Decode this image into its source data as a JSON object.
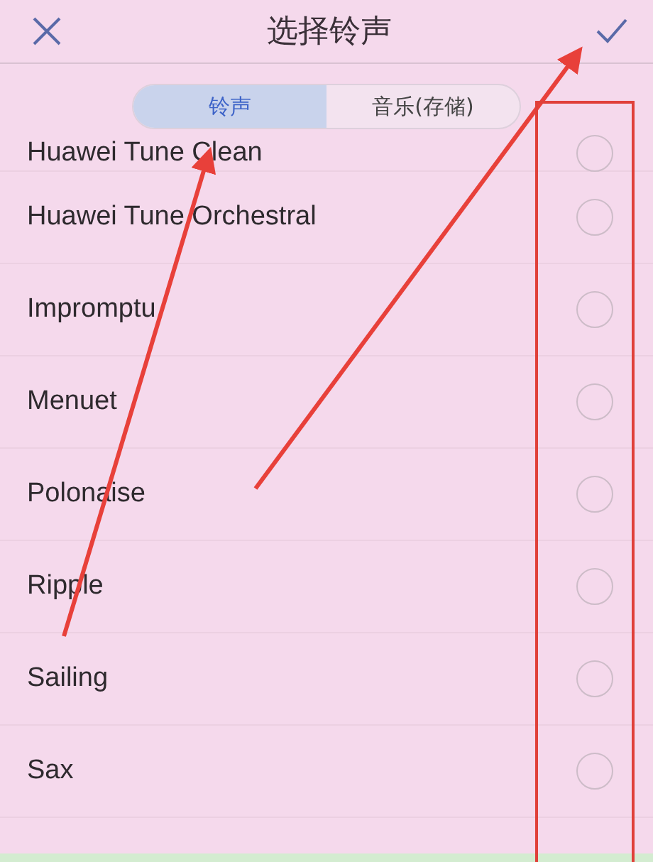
{
  "header": {
    "title": "选择铃声"
  },
  "tabs": [
    {
      "label": "铃声",
      "selected": true
    },
    {
      "label": "音乐(存储)",
      "selected": false
    }
  ],
  "ringtones": [
    {
      "name": "Huawei Tune Clean",
      "selected": false
    },
    {
      "name": "Huawei Tune Orchestral",
      "selected": false
    },
    {
      "name": "Impromptu",
      "selected": false
    },
    {
      "name": "Menuet",
      "selected": false
    },
    {
      "name": "Polonaise",
      "selected": false
    },
    {
      "name": "Ripple",
      "selected": false
    },
    {
      "name": "Sailing",
      "selected": false
    },
    {
      "name": "Sax",
      "selected": false
    }
  ]
}
